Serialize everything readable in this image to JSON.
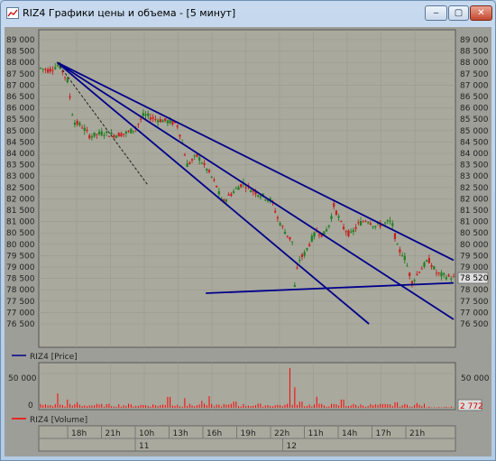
{
  "window": {
    "title": "RIZ4 Графики цены и объема - [5 минут]",
    "buttons": {
      "minimize": "‒",
      "maximize": "▢",
      "close": "✕"
    }
  },
  "colors": {
    "plot_bg": "#a9a99d",
    "panel_bg": "#9e9e98",
    "trendline": "#00008b",
    "candle": "#c82020",
    "candle_alt": "#208020",
    "volume": "#ff0000"
  },
  "price_panel": {
    "y_ticks": [
      "89 000",
      "88 500",
      "88 000",
      "87 500",
      "87 000",
      "86 500",
      "86 000",
      "85 500",
      "85 000",
      "84 500",
      "84 000",
      "83 500",
      "83 000",
      "82 500",
      "82 000",
      "81 500",
      "81 000",
      "80 500",
      "80 000",
      "79 500",
      "79 000",
      "78 500",
      "78 000",
      "77 500",
      "77 000",
      "76 500"
    ],
    "last_price": "78 520",
    "legend": "RIZ4 [Price]"
  },
  "volume_panel": {
    "y_ticks": [
      "50 000",
      "0"
    ],
    "last_volume": "2 772",
    "legend": "RIZ4 [Volume]"
  },
  "time_axis": {
    "hour_labels": [
      "18h",
      "21h",
      "10h",
      "13h",
      "16h",
      "19h",
      "22h",
      "11h",
      "14h",
      "17h",
      "21h"
    ],
    "day_labels": [
      "11",
      "12"
    ]
  },
  "chart_data": {
    "type": "candlestick",
    "price_range": [
      76500,
      89000
    ],
    "volume_range": [
      0,
      50000
    ],
    "price_path": [
      [
        0,
        87750
      ],
      [
        0.02,
        87650
      ],
      [
        0.045,
        87900
      ],
      [
        0.065,
        87200
      ],
      [
        0.08,
        85400
      ],
      [
        0.1,
        85200
      ],
      [
        0.12,
        84750
      ],
      [
        0.15,
        84900
      ],
      [
        0.18,
        84800
      ],
      [
        0.21,
        84900
      ],
      [
        0.23,
        85100
      ],
      [
        0.25,
        85700
      ],
      [
        0.28,
        85500
      ],
      [
        0.31,
        85400
      ],
      [
        0.33,
        85300
      ],
      [
        0.34,
        84700
      ],
      [
        0.355,
        83500
      ],
      [
        0.38,
        83900
      ],
      [
        0.41,
        83100
      ],
      [
        0.425,
        82600
      ],
      [
        0.44,
        81800
      ],
      [
        0.46,
        82200
      ],
      [
        0.49,
        82700
      ],
      [
        0.51,
        82400
      ],
      [
        0.54,
        82100
      ],
      [
        0.56,
        81900
      ],
      [
        0.575,
        81100
      ],
      [
        0.59,
        80600
      ],
      [
        0.61,
        80100
      ],
      [
        0.615,
        78100
      ],
      [
        0.625,
        79300
      ],
      [
        0.64,
        79600
      ],
      [
        0.655,
        80200
      ],
      [
        0.67,
        80600
      ],
      [
        0.685,
        80400
      ],
      [
        0.7,
        80900
      ],
      [
        0.71,
        81700
      ],
      [
        0.73,
        80800
      ],
      [
        0.75,
        80400
      ],
      [
        0.77,
        80900
      ],
      [
        0.79,
        81100
      ],
      [
        0.81,
        80800
      ],
      [
        0.83,
        80900
      ],
      [
        0.85,
        81000
      ],
      [
        0.865,
        79800
      ],
      [
        0.88,
        79500
      ],
      [
        0.89,
        78900
      ],
      [
        0.9,
        78300
      ],
      [
        0.915,
        78800
      ],
      [
        0.94,
        79300
      ],
      [
        0.96,
        78700
      ],
      [
        0.98,
        78600
      ],
      [
        1,
        78520
      ]
    ],
    "volume_spikes": [
      [
        0.04,
        21000
      ],
      [
        0.065,
        12000
      ],
      [
        0.09,
        8000
      ],
      [
        0.31,
        16000
      ],
      [
        0.35,
        14000
      ],
      [
        0.39,
        10000
      ],
      [
        0.41,
        17000
      ],
      [
        0.47,
        9000
      ],
      [
        0.53,
        6000
      ],
      [
        0.605,
        58000
      ],
      [
        0.615,
        30000
      ],
      [
        0.63,
        9000
      ],
      [
        0.67,
        16000
      ],
      [
        0.73,
        12000
      ],
      [
        0.86,
        8000
      ],
      [
        0.91,
        7000
      ]
    ],
    "trendlines": [
      {
        "style": "solid",
        "from": [
          0.04,
          88000
        ],
        "to": [
          1.0,
          79300
        ]
      },
      {
        "style": "solid",
        "from": [
          0.04,
          88000
        ],
        "to": [
          1.0,
          76700
        ]
      },
      {
        "style": "solid",
        "from": [
          0.04,
          88000
        ],
        "to": [
          0.795,
          76500
        ]
      },
      {
        "style": "solid",
        "from": [
          0.4,
          77850
        ],
        "to": [
          1.0,
          78300
        ]
      },
      {
        "style": "dashed",
        "from": [
          0.04,
          88000
        ],
        "to": [
          0.26,
          82600
        ]
      }
    ]
  }
}
